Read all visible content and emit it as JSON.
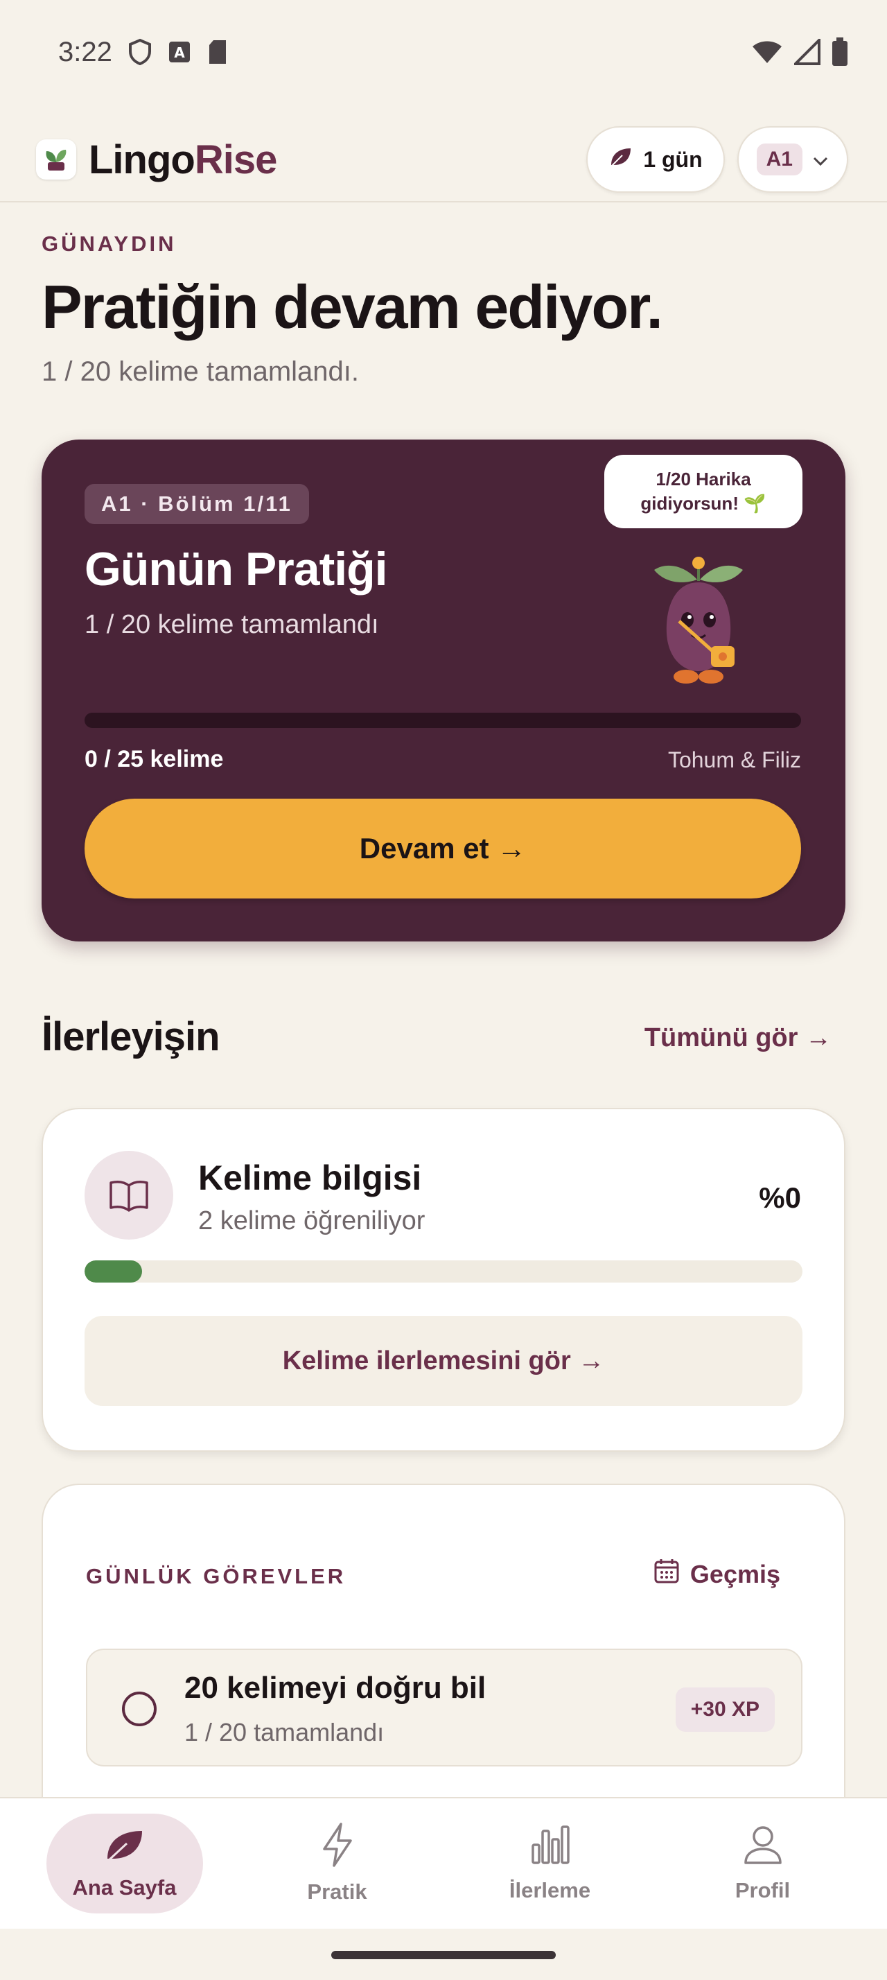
{
  "status_bar": {
    "time": "3:22"
  },
  "header": {
    "brand_part1": "Lingo",
    "brand_part2": "Rise",
    "streak_label": "1 gün",
    "level": "A1"
  },
  "greeting": {
    "eyebrow": "GÜNAYDIN",
    "title": "Pratiğin devam ediyor.",
    "subtitle": "1 / 20 kelime tamamlandı."
  },
  "practice_card": {
    "unit_chip": "A1 · Bölüm 1/11",
    "bubble_text": "1/20 Harika gidiyorsun! 🌱",
    "title": "Günün Pratiği",
    "subtitle": "1 / 20 kelime tamamlandı",
    "progress_fraction": 0.0,
    "count_label": "0 / 25 kelime",
    "stage_label": "Tohum & Filiz",
    "continue_label": "Devam et →"
  },
  "progress_section": {
    "title": "İlerleyişin",
    "see_all": "Tümünü gör →"
  },
  "vocab_card": {
    "title": "Kelime bilgisi",
    "subtitle": "2 kelime öğreniliyor",
    "percent": "%0",
    "bar_fraction": 0.08,
    "button_label": "Kelime ilerlemesini gör →"
  },
  "daily_tasks": {
    "eyebrow": "GÜNLÜK GÖREVLER",
    "history_label": "Geçmiş",
    "tasks": [
      {
        "title": "20 kelimeyi doğru bil",
        "subtitle": "1 / 20 tamamlandı",
        "xp": "+30 XP"
      }
    ]
  },
  "bottom_nav": {
    "items": [
      {
        "label": "Ana Sayfa",
        "icon": "leaf-icon",
        "active": true
      },
      {
        "label": "Pratik",
        "icon": "lightning-icon",
        "active": false
      },
      {
        "label": "İlerleme",
        "icon": "bar-chart-icon",
        "active": false
      },
      {
        "label": "Profil",
        "icon": "person-icon",
        "active": false
      }
    ]
  },
  "colors": {
    "background": "#F6F2EA",
    "brand": "#6A2F4A",
    "card_dark": "#4A2438",
    "accent": "#F2AE3C",
    "success": "#4F8A4A"
  }
}
